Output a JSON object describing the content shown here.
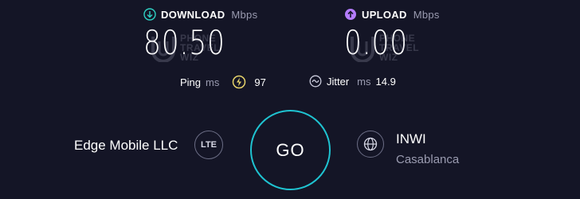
{
  "download": {
    "label": "DOWNLOAD",
    "unit": "Mbps",
    "value": "80.50",
    "icon": "arrow-down-circle-icon",
    "color": "#2fd1c4"
  },
  "upload": {
    "label": "UPLOAD",
    "unit": "Mbps",
    "value": "0.00",
    "icon": "arrow-up-circle-icon",
    "color": "#b47cff"
  },
  "ping": {
    "label": "Ping",
    "unit": "ms",
    "value": "97",
    "icon_color": "#e6d36a"
  },
  "jitter": {
    "label": "Jitter",
    "unit": "ms",
    "value": "14.9"
  },
  "watermark": {
    "line1": "PHONE",
    "line2": "TRAVEL",
    "line3": "WIZ"
  },
  "connection": {
    "provider": "Edge Mobile LLC",
    "type": "LTE"
  },
  "go_button": {
    "label": "GO",
    "color": "#1fc3d1"
  },
  "server": {
    "name": "INWI",
    "location": "Casablanca"
  }
}
